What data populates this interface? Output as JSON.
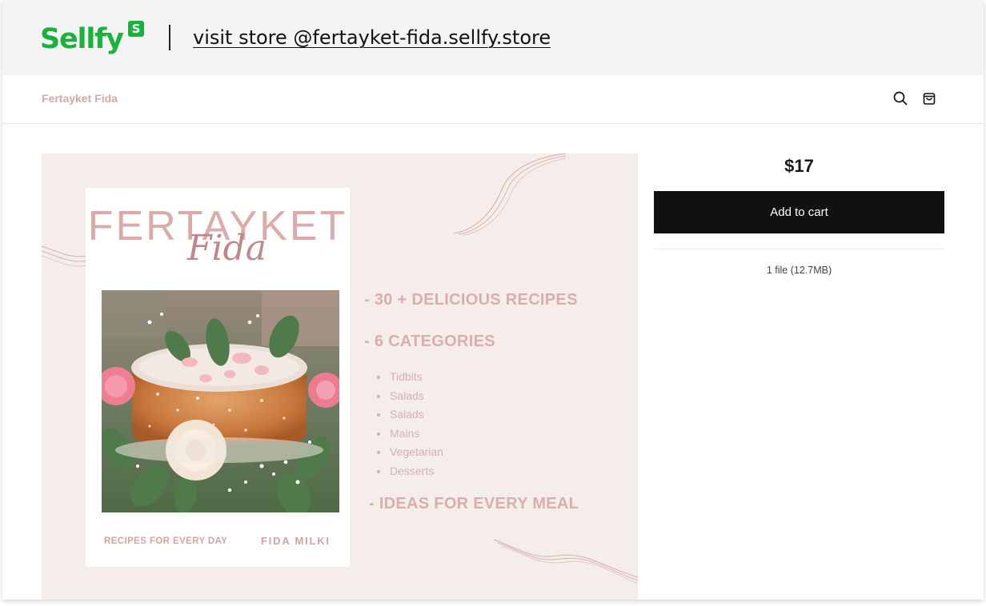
{
  "banner": {
    "logo_text": "Sellfy",
    "logo_badge": "S",
    "visit_link": "visit store @fertayket-fida.sellfy.store"
  },
  "header": {
    "store_name": "Fertayket Fida",
    "icons": [
      "search-icon",
      "cart-icon"
    ]
  },
  "product_image": {
    "book": {
      "title": "FERTAYKET",
      "script_title": "Fida",
      "footer_left": "RECIPES FOR EVERY DAY",
      "footer_right": "FIDA MILKI"
    },
    "features": [
      "- 30 + DELICIOUS RECIPES",
      "- 6 CATEGORIES",
      "- IDEAS FOR EVERY MEAL"
    ],
    "categories": [
      "Tidbits",
      "Salads",
      "Salads",
      "Mains",
      "Vegetarian",
      "Desserts"
    ]
  },
  "purchase": {
    "price": "$17",
    "add_to_cart_label": "Add to cart",
    "file_info": "1 file (12.7MB)"
  },
  "colors": {
    "brand_green": "#1bb13d",
    "store_name_pink": "#d4a9a9",
    "cta_black": "#111111",
    "image_bg": "#f4edea"
  }
}
